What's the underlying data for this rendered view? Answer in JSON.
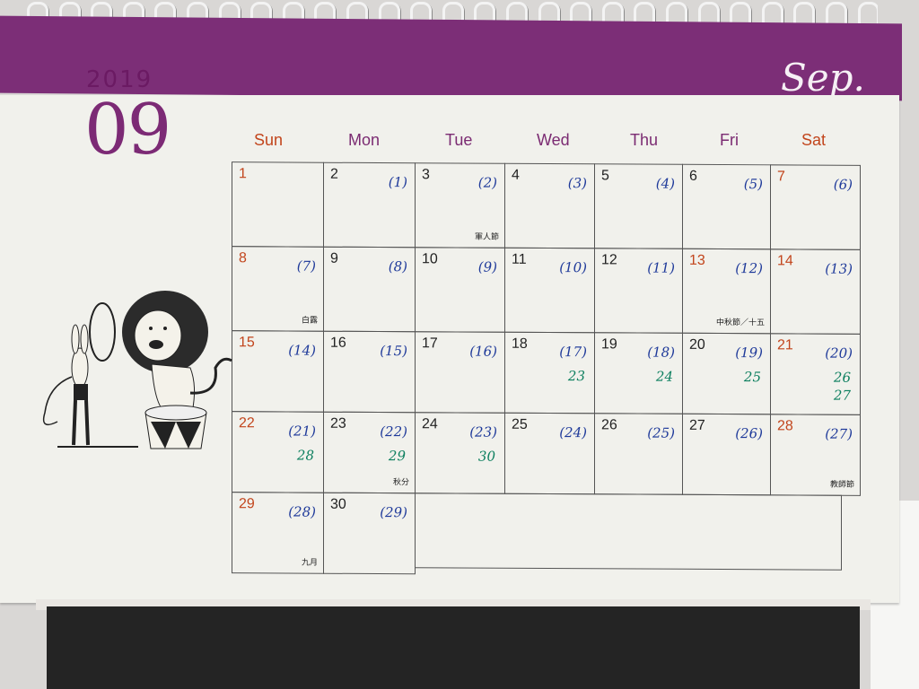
{
  "calendar": {
    "year": "2019",
    "month_number": "09",
    "month_name": "Sep.",
    "weekdays": [
      "Sun",
      "Mon",
      "Tue",
      "Wed",
      "Thu",
      "Fri",
      "Sat"
    ],
    "weeks": [
      [
        {
          "day": "1",
          "red": true,
          "lunar": "",
          "note": "",
          "holiday": ""
        },
        {
          "day": "2",
          "lunar": "(1)",
          "note": "",
          "holiday": ""
        },
        {
          "day": "3",
          "lunar": "(2)",
          "note": "",
          "holiday": "軍人節"
        },
        {
          "day": "4",
          "lunar": "(3)",
          "note": "",
          "holiday": ""
        },
        {
          "day": "5",
          "lunar": "(4)",
          "note": "",
          "holiday": ""
        },
        {
          "day": "6",
          "lunar": "(5)",
          "note": "",
          "holiday": ""
        },
        {
          "day": "7",
          "red": true,
          "lunar": "(6)",
          "note": "",
          "holiday": ""
        }
      ],
      [
        {
          "day": "8",
          "red": true,
          "lunar": "(7)",
          "note": "",
          "holiday": "白露"
        },
        {
          "day": "9",
          "lunar": "(8)",
          "note": "",
          "holiday": ""
        },
        {
          "day": "10",
          "lunar": "(9)",
          "note": "",
          "holiday": ""
        },
        {
          "day": "11",
          "lunar": "(10)",
          "note": "",
          "holiday": ""
        },
        {
          "day": "12",
          "lunar": "(11)",
          "note": "",
          "holiday": ""
        },
        {
          "day": "13",
          "red": true,
          "lunar": "(12)",
          "note": "",
          "holiday": "中秋節／十五"
        },
        {
          "day": "14",
          "red": true,
          "lunar": "(13)",
          "note": "",
          "holiday": ""
        }
      ],
      [
        {
          "day": "15",
          "red": true,
          "lunar": "(14)",
          "note": "",
          "holiday": ""
        },
        {
          "day": "16",
          "lunar": "(15)",
          "note": "",
          "holiday": ""
        },
        {
          "day": "17",
          "lunar": "(16)",
          "note": "",
          "holiday": ""
        },
        {
          "day": "18",
          "lunar": "(17)",
          "note": "23",
          "holiday": ""
        },
        {
          "day": "19",
          "lunar": "(18)",
          "note": "24",
          "holiday": ""
        },
        {
          "day": "20",
          "lunar": "(19)",
          "note": "25",
          "holiday": ""
        },
        {
          "day": "21",
          "red": true,
          "lunar": "(20)",
          "note": "26\n27",
          "holiday": ""
        }
      ],
      [
        {
          "day": "22",
          "red": true,
          "lunar": "(21)",
          "note": "28",
          "holiday": ""
        },
        {
          "day": "23",
          "lunar": "(22)",
          "note": "29",
          "holiday": "秋分"
        },
        {
          "day": "24",
          "lunar": "(23)",
          "note": "30",
          "holiday": ""
        },
        {
          "day": "25",
          "lunar": "(24)",
          "note": "",
          "holiday": ""
        },
        {
          "day": "26",
          "lunar": "(25)",
          "note": "",
          "holiday": ""
        },
        {
          "day": "27",
          "lunar": "(26)",
          "note": "",
          "holiday": ""
        },
        {
          "day": "28",
          "red": true,
          "lunar": "(27)",
          "note": "",
          "holiday": "教師節"
        }
      ],
      [
        {
          "day": "29",
          "red": true,
          "lunar": "(28)",
          "note": "",
          "holiday": "九月"
        },
        {
          "day": "30",
          "lunar": "(29)",
          "note": "",
          "holiday": ""
        }
      ]
    ]
  },
  "colors": {
    "header": "#7c2e77",
    "weekend_red": "#c2451c",
    "lunar_blue": "#1f3a9a",
    "note_green": "#0f8060"
  }
}
